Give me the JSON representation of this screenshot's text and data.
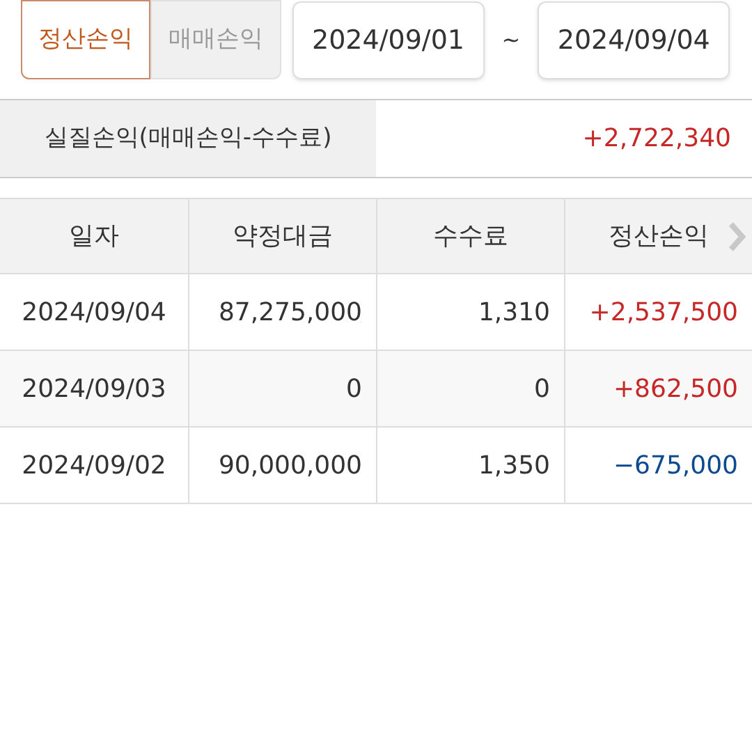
{
  "tabs": [
    {
      "label": "정산손익",
      "selected": true
    },
    {
      "label": "매매손익",
      "selected": false
    }
  ],
  "date_range": {
    "from": "2024/09/01",
    "separator": "~",
    "to": "2024/09/04"
  },
  "summary": {
    "label": "실질손익(매매손익-수수료)",
    "value": "+2,722,340",
    "color": "#c62828"
  },
  "table": {
    "columns": [
      "일자",
      "약정대금",
      "수수료",
      "정산손익"
    ],
    "rows": [
      {
        "date": "2024/09/04",
        "amount": "87,275,000",
        "fee": "1,310",
        "pnl": "+2,537,500",
        "color": "#c62828"
      },
      {
        "date": "2024/09/03",
        "amount": "0",
        "fee": "0",
        "pnl": "+862,500",
        "color": "#c62828"
      },
      {
        "date": "2024/09/02",
        "amount": "90,000,000",
        "fee": "1,350",
        "pnl": "−675,000",
        "color": "#0d4a8f"
      }
    ]
  }
}
